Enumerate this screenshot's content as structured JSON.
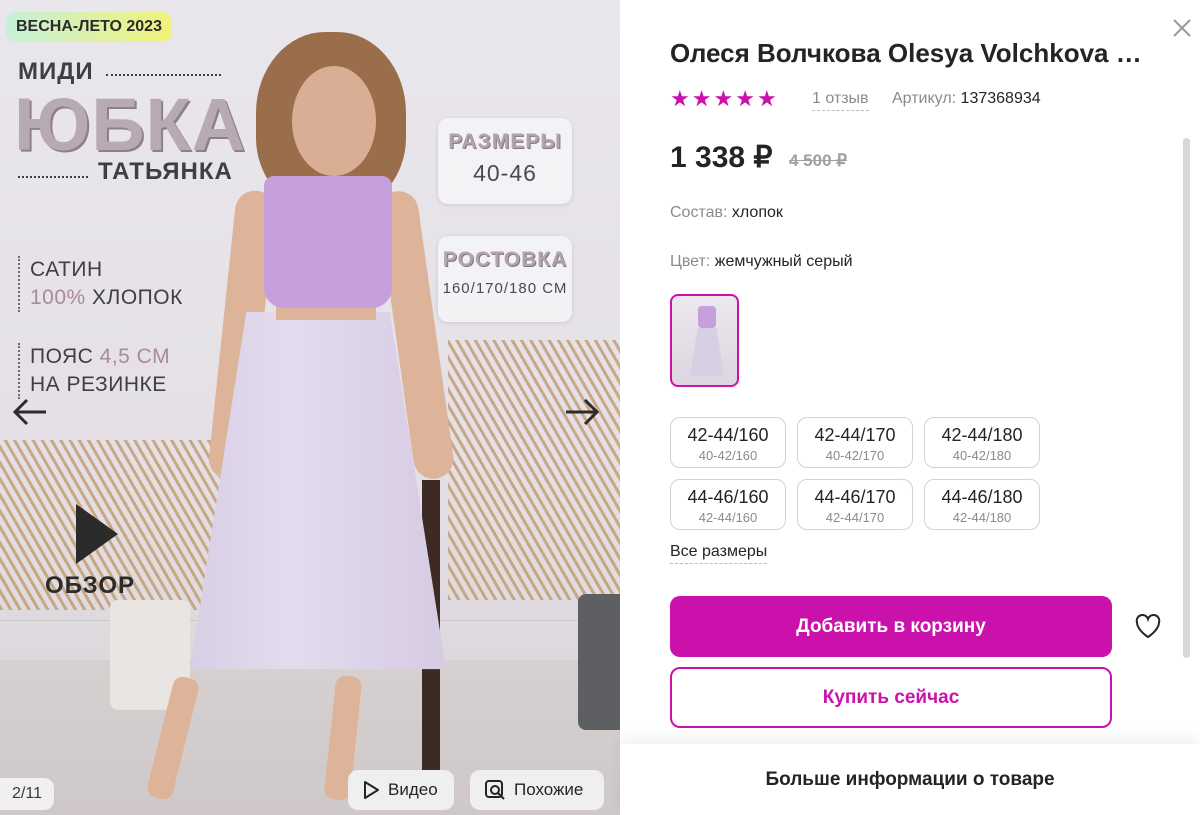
{
  "gallery": {
    "season_badge": "ВЕСНА-ЛЕТО 2023",
    "midi": "МИДИ",
    "skirt_word": "ЮБКА",
    "tatyanka": "ТАТЬЯНКА",
    "feature1": {
      "line1": "САТИН",
      "line2_highlight": "100%",
      "line2_rest": " ХЛОПОК"
    },
    "feature2": {
      "line1_a": "ПОЯС ",
      "line1_highlight": "4,5 СМ",
      "line2": "НА РЕЗИНКЕ"
    },
    "size_card": {
      "title": "РАЗМЕРЫ",
      "value": "40-46"
    },
    "height_card": {
      "title": "РОСТОВКА",
      "value": "160/170/180 СМ"
    },
    "review_label": "ОБЗОР",
    "counter": "2/11",
    "video_label": "Видео",
    "similar_label": "Похожие"
  },
  "product": {
    "title": "Олеся Волчкова Olesya Volchkova Юбка",
    "rating": 5,
    "reviews": "1 отзыв",
    "article_label": "Артикул:",
    "article_value": "137368934",
    "price": "1 338 ₽",
    "old_price": "4 500 ₽",
    "composition_label": "Состав:",
    "composition_value": "хлопок",
    "color_label": "Цвет:",
    "color_value": "жемчужный серый",
    "sizes": [
      {
        "main": "42-44/160",
        "sub": "40-42/160"
      },
      {
        "main": "42-44/170",
        "sub": "40-42/170"
      },
      {
        "main": "42-44/180",
        "sub": "40-42/180"
      },
      {
        "main": "44-46/160",
        "sub": "42-44/160"
      },
      {
        "main": "44-46/170",
        "sub": "42-44/170"
      },
      {
        "main": "44-46/180",
        "sub": "42-44/180"
      }
    ],
    "all_sizes": "Все размеры",
    "add_to_cart": "Добавить в корзину",
    "buy_now": "Купить сейчас",
    "more_info": "Больше информации о товаре"
  },
  "colors": {
    "accent": "#cb11ab",
    "text": "#242424",
    "muted": "#8b8b8b"
  },
  "icons": [
    "close-icon",
    "star-icon",
    "arrow-left-icon",
    "arrow-right-icon",
    "play-icon",
    "video-icon",
    "similar-search-icon",
    "heart-icon"
  ]
}
